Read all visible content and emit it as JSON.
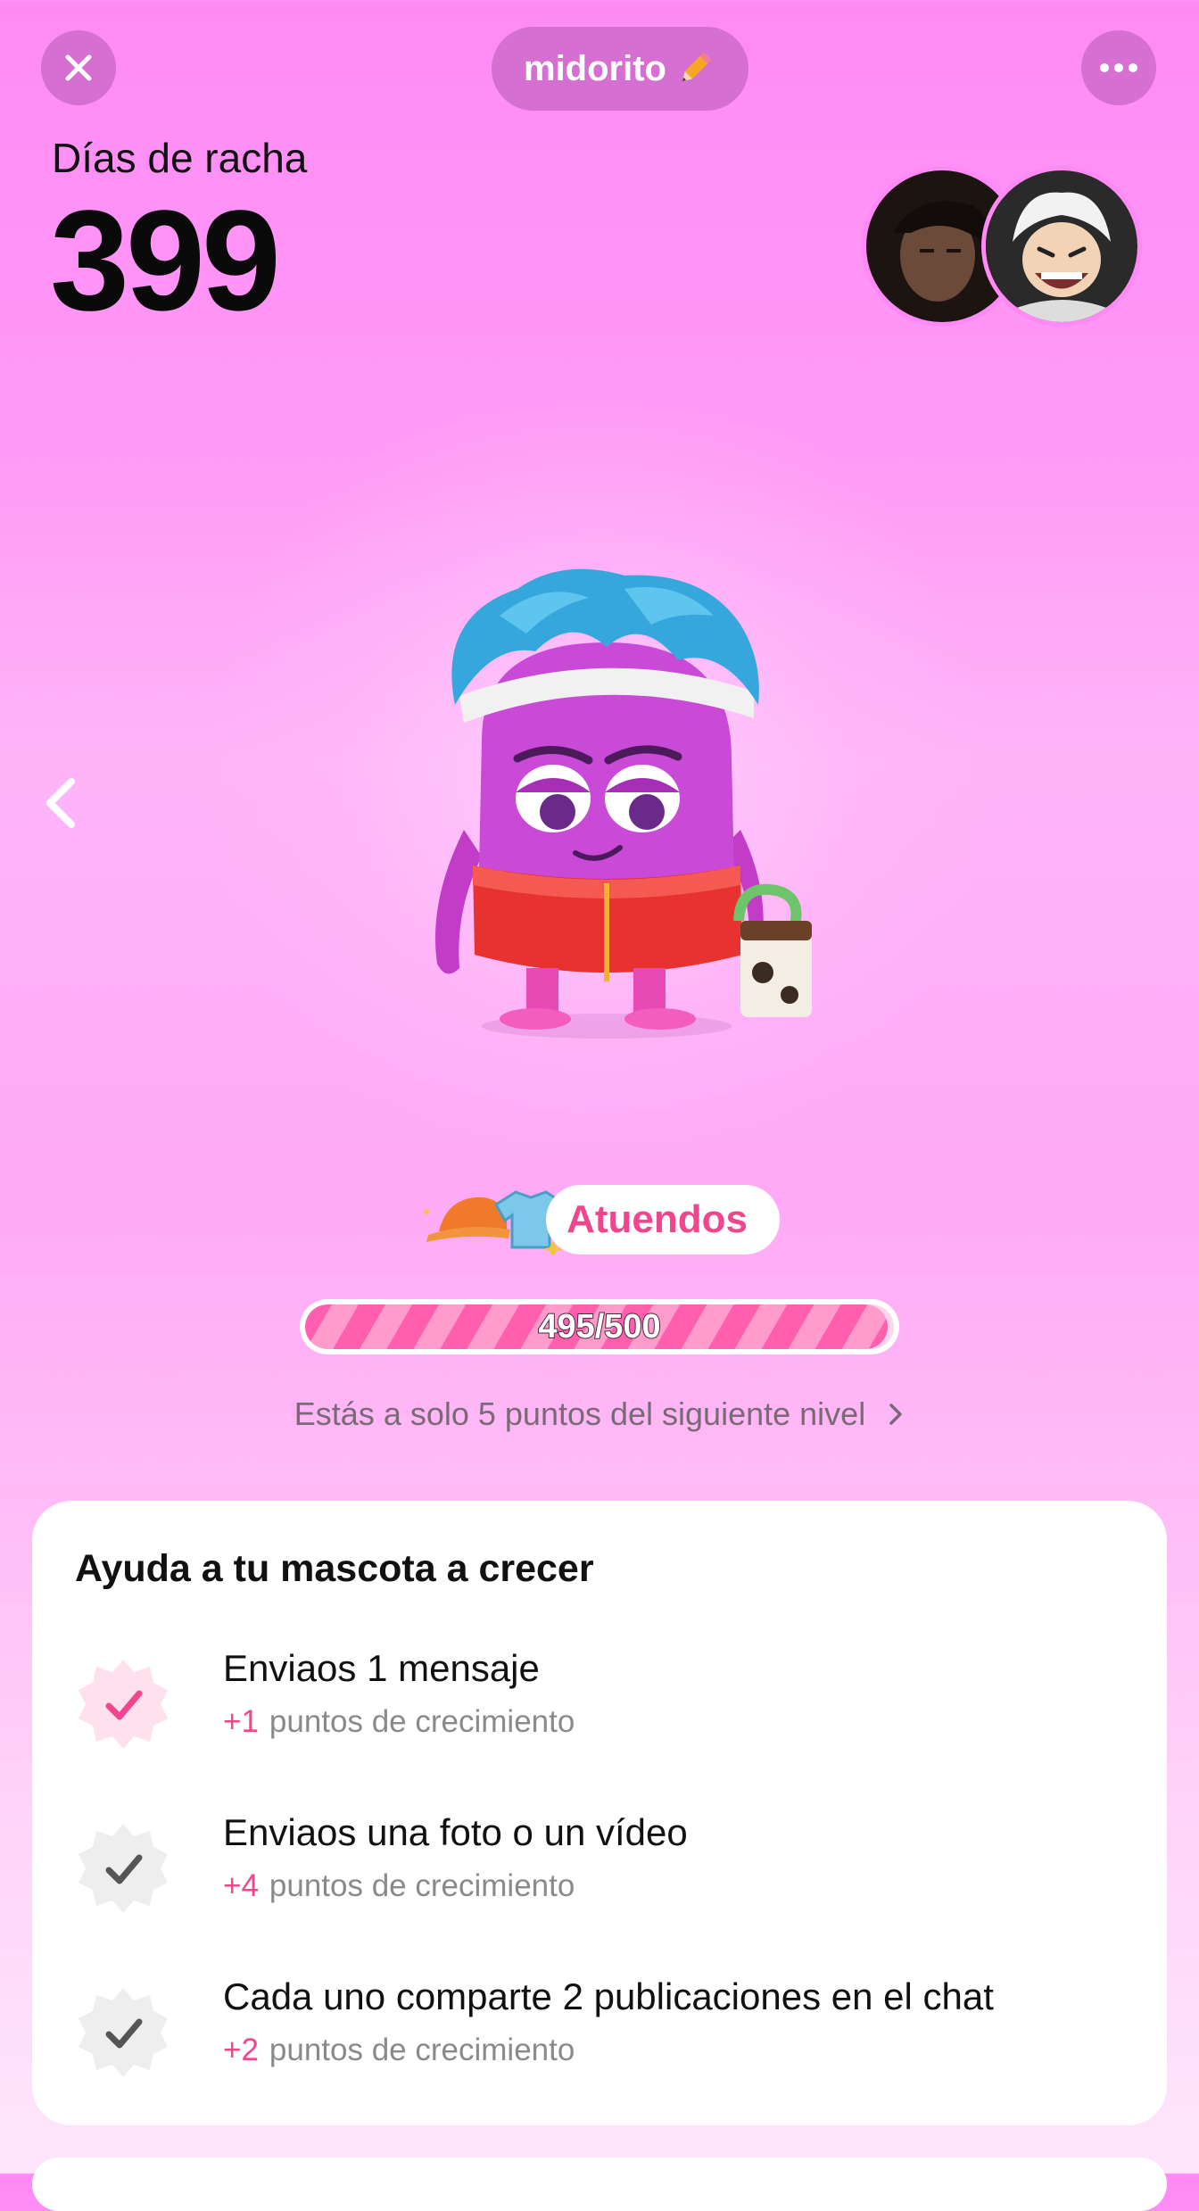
{
  "header": {
    "title": "midorito",
    "title_icon": "pencil-icon",
    "close_icon": "close-icon",
    "more_icon": "more-icon"
  },
  "streak": {
    "label": "Días de racha",
    "count": "399"
  },
  "pet": {
    "outfits_label": "Atuendos",
    "progress_text": "495/500",
    "progress_fraction": 0.99,
    "next_level_text": "Estás a solo 5 puntos del siguiente nivel"
  },
  "tasks_card": {
    "title": "Ayuda a tu mascota a crecer",
    "items": [
      {
        "title": "Enviaos 1 mensaje",
        "points": "+1",
        "suffix": "puntos de crecimiento",
        "done": true
      },
      {
        "title": "Enviaos una foto o un vídeo",
        "points": "+4",
        "suffix": "puntos de crecimiento",
        "done": false
      },
      {
        "title": "Cada uno comparte 2 publicaciones en el chat",
        "points": "+2",
        "suffix": "puntos de crecimiento",
        "done": false
      }
    ]
  },
  "colors": {
    "accent": "#f0468e",
    "header_button": "#d56fd1",
    "background_top": "#ff8af6"
  }
}
